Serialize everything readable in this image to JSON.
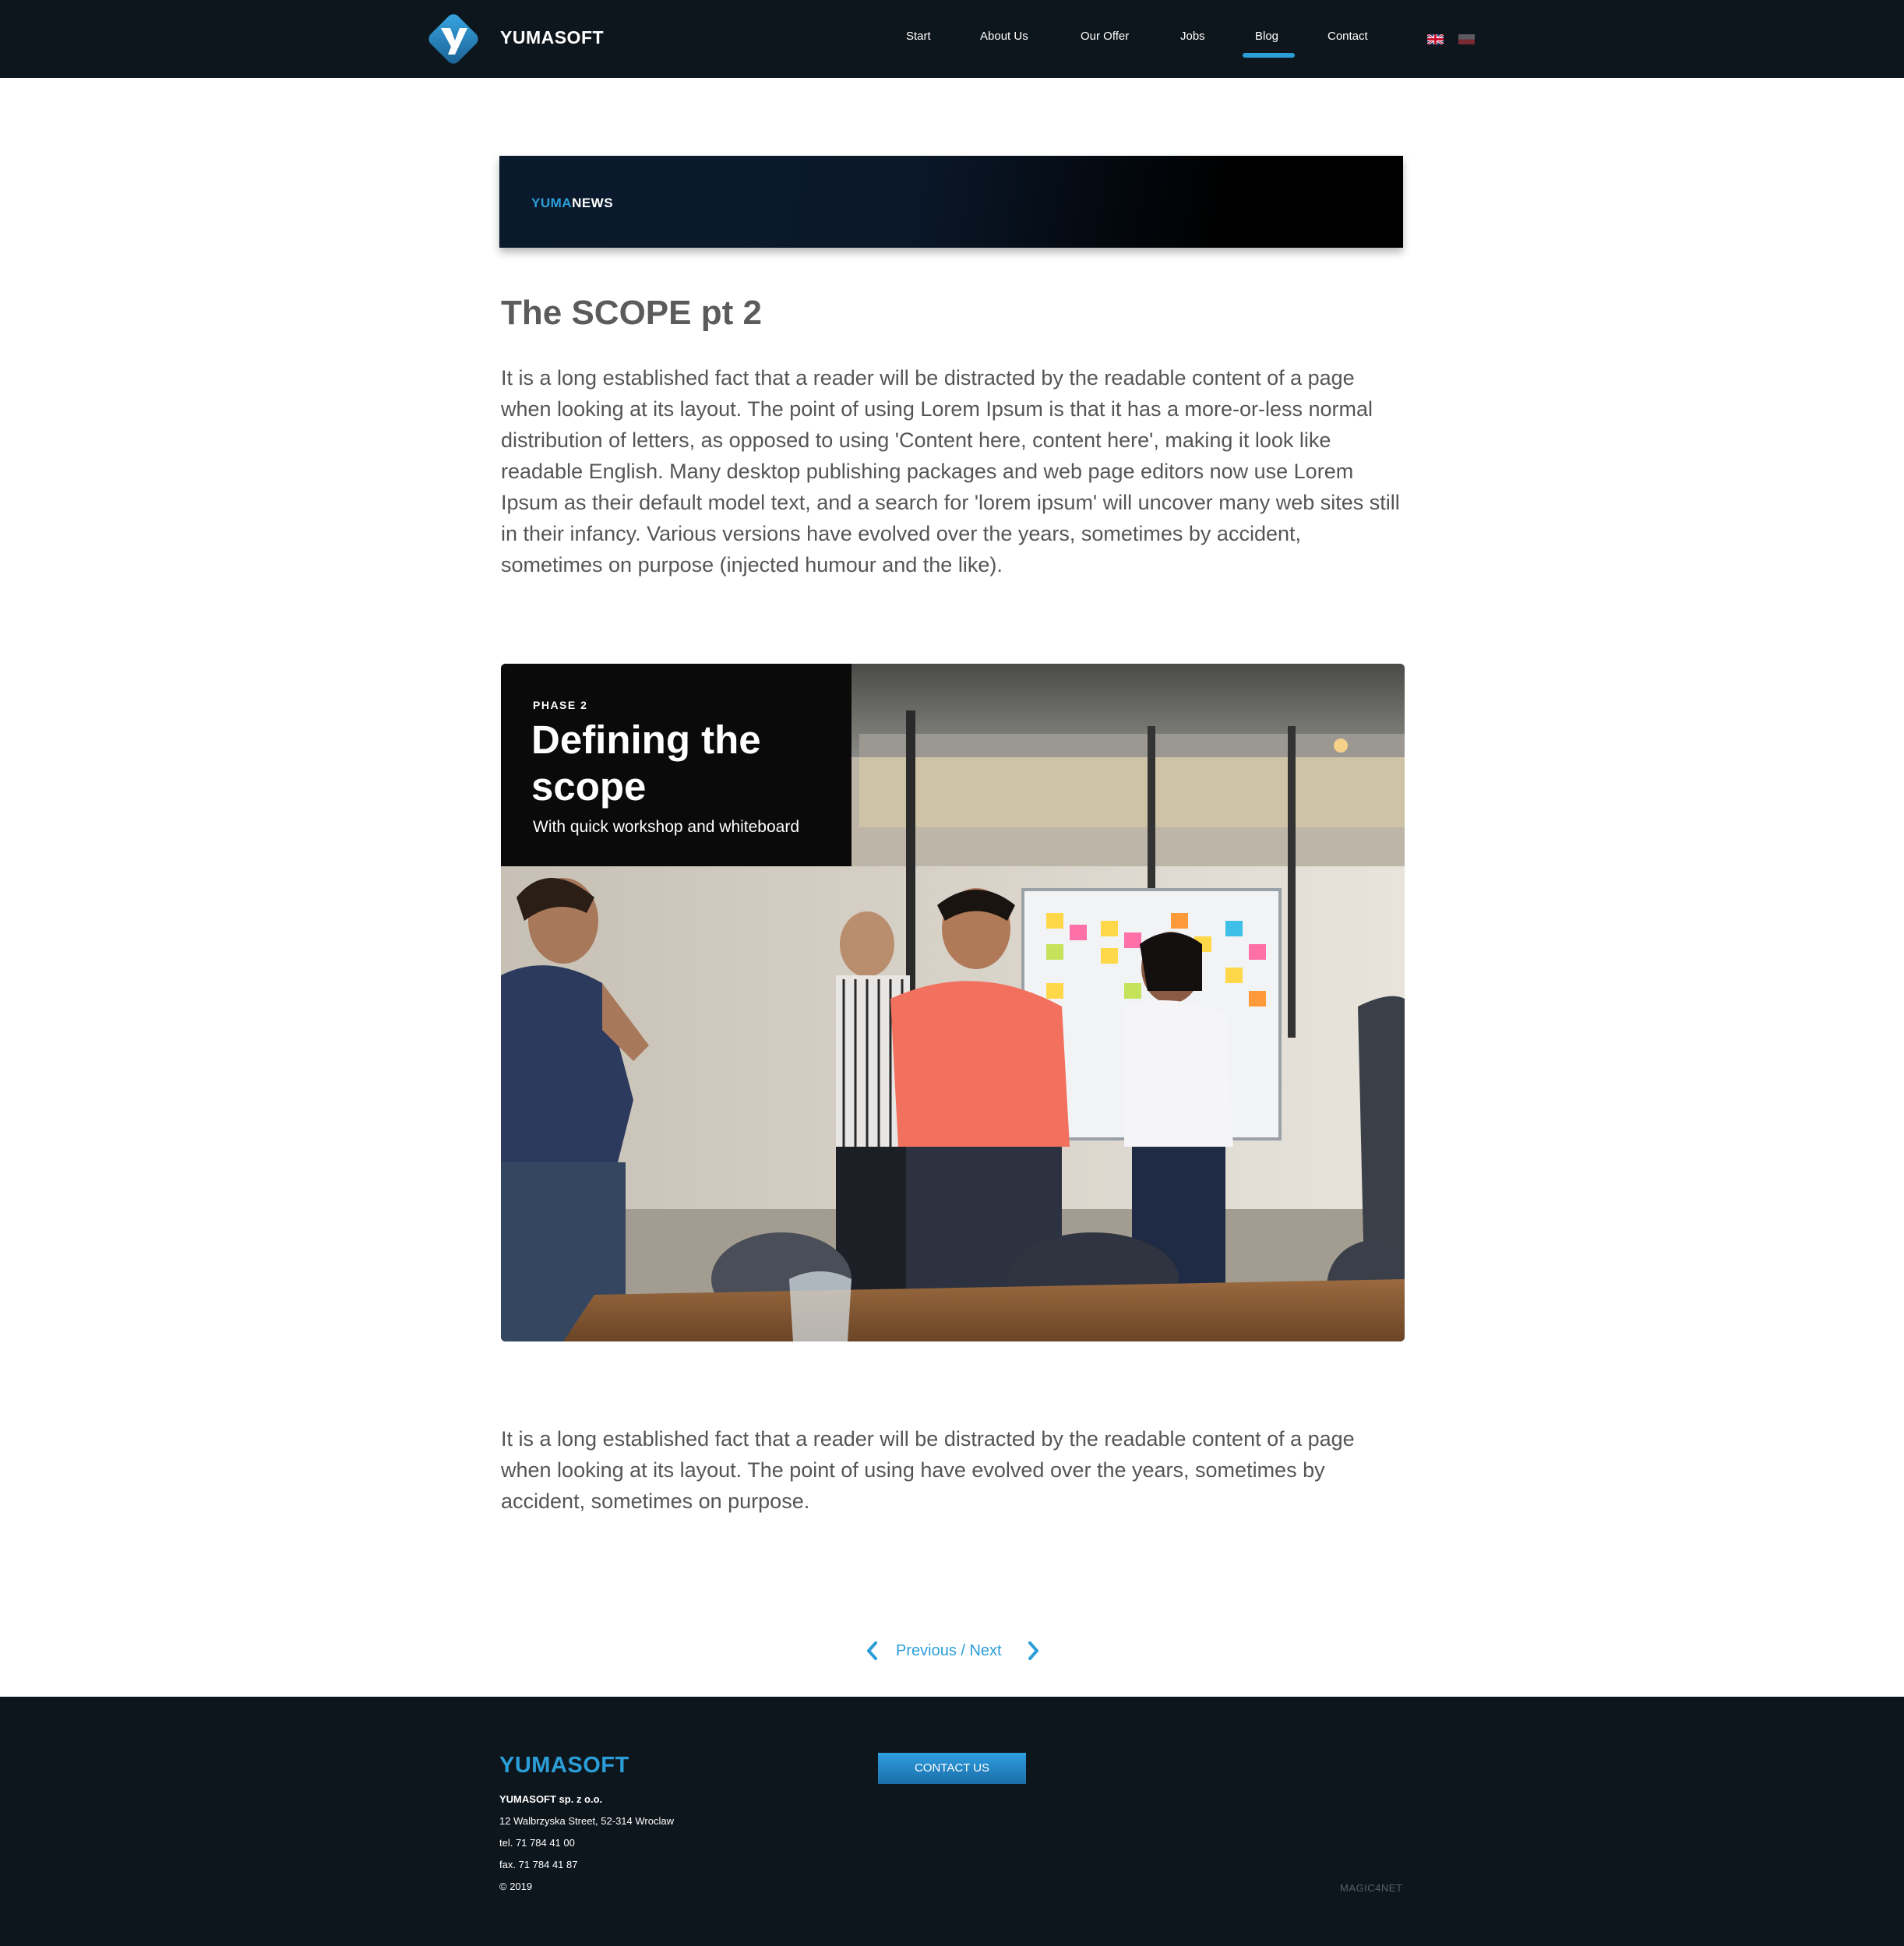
{
  "header": {
    "brand": "YUMASOFT",
    "nav": [
      {
        "label": "Start"
      },
      {
        "label": "About Us"
      },
      {
        "label": "Our Offer"
      },
      {
        "label": "Jobs"
      },
      {
        "label": "Blog",
        "active": true
      },
      {
        "label": "Contact"
      }
    ],
    "languages": [
      "en-flag-icon",
      "pl-flag-icon"
    ]
  },
  "banner": {
    "part1": "YUMA",
    "part2": "NEWS"
  },
  "article": {
    "title": "The SCOPE pt 2",
    "paragraph1": "It is a long established fact that a reader will be distracted by the readable content of a page when looking at its layout. The point of using Lorem Ipsum is that it has a more-or-less normal distribution of letters, as opposed to using 'Content here, content here', making it look like readable English. Many desktop publishing packages and web page editors now use Lorem Ipsum as their default model text, and a search for 'lorem ipsum' will uncover many web sites still in their infancy. Various versions have evolved over the years, sometimes by accident, sometimes on purpose (injected humour and the like).",
    "image": {
      "phase": "PHASE 2",
      "title": "Defining the scope",
      "subtitle": "With quick workshop and whiteboard"
    },
    "paragraph2": "It is a long established fact that a reader will be distracted by the readable content of a page when looking at its layout. The point of using  have evolved over the years, sometimes by accident, sometimes on purpose."
  },
  "pager": {
    "label": "Previous / Next"
  },
  "footer": {
    "brand": "YUMASOFT",
    "company": "YUMASOFT sp. z o.o.",
    "address": "12 Walbrzyska Street, 52-314 Wroclaw",
    "tel": "tel. 71 784 41 00",
    "fax": "fax. 71 784 41 87",
    "copyright": "© 2019",
    "contact_button": "CONTACT US",
    "credit": "MAGIC4NET"
  },
  "colors": {
    "accent": "#2b9ed8",
    "dark": "#0e161d"
  }
}
